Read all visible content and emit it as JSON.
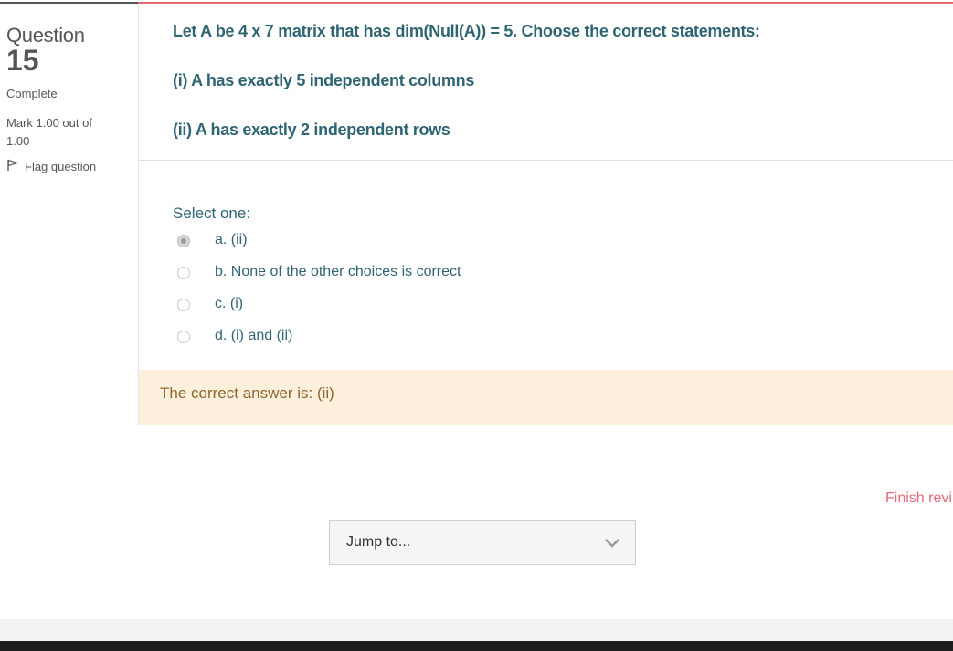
{
  "info": {
    "question_label": "Question",
    "question_number": "15",
    "state": "Complete",
    "grade": "Mark 1.00 out of 1.00",
    "flag_label": "Flag question"
  },
  "question": {
    "lines": [
      "Let A be 4 x 7 matrix that has dim(Null(A)) = 5. Choose the correct statements:",
      "(i) A has exactly 5 independent columns",
      "(ii) A has exactly 2 independent rows"
    ],
    "prompt": "Select one:",
    "options": [
      {
        "label": "a. (ii)",
        "checked": true
      },
      {
        "label": "b. None of the other choices is correct",
        "checked": false
      },
      {
        "label": "c. (i)",
        "checked": false
      },
      {
        "label": "d. (i) and (ii)",
        "checked": false
      }
    ],
    "feedback": "The correct answer is: (ii)"
  },
  "nav": {
    "finish_review": "Finish revi",
    "jump_to": "Jump to..."
  },
  "colors": {
    "accent": "#e56a7a",
    "question_text": "#2f6473",
    "feedback_bg": "#fcefdc",
    "feedback_text": "#8e662e"
  }
}
